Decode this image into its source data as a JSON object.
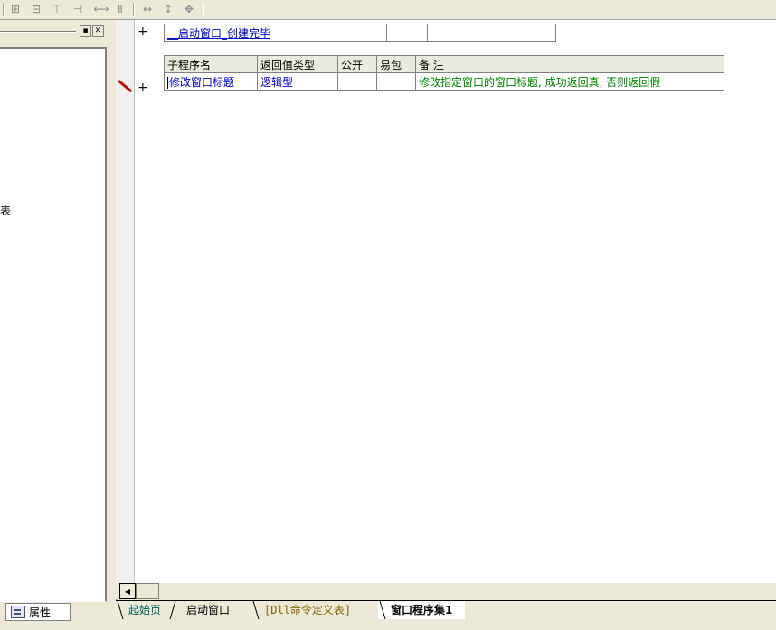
{
  "toolbar": {
    "icons": [
      "align-left-icon",
      "align-center-icon",
      "align-top-icon",
      "align-right-icon",
      "same-width-icon",
      "same-height-icon",
      "width-icon",
      "height-icon",
      "size-icon"
    ]
  },
  "left_panel": {
    "stray_text": "表",
    "properties_tab_label": "属性"
  },
  "editor": {
    "event_row": {
      "name": "__启动窗口_创建完毕"
    },
    "sub_table": {
      "headers": [
        "子程序名",
        "返回值类型",
        "公开",
        "易包",
        "备 注"
      ],
      "rows": [
        {
          "name": "修改窗口标题",
          "return_type": "逻辑型",
          "public": "",
          "easy_pkg": "",
          "remark": "修改指定窗口的窗口标题, 成功返回真, 否则返回假"
        }
      ]
    }
  },
  "tabs": [
    {
      "label": "起始页",
      "active": false
    },
    {
      "label": "_启动窗口",
      "active": false
    },
    {
      "label": "[Dll命令定义表]",
      "active": false
    },
    {
      "label": "窗口程序集1",
      "active": true
    }
  ],
  "colors": {
    "link_blue": "#0000c0",
    "remark_green": "#008000",
    "header_bg": "#e6ebde"
  }
}
